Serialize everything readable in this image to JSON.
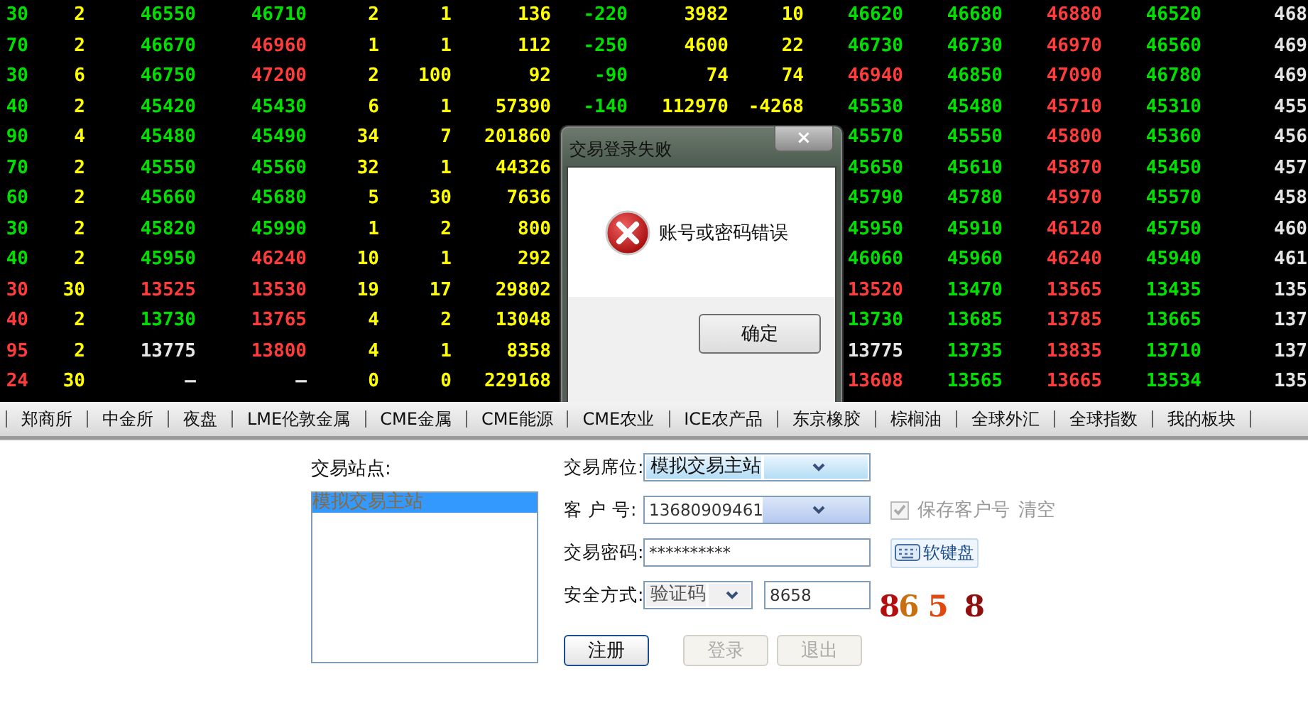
{
  "quotes": {
    "rows": [
      {
        "cells": [
          {
            "text": "30",
            "color": "#00e000"
          },
          {
            "text": "2",
            "color": "#ffff00"
          },
          {
            "text": "46550",
            "color": "#00e000"
          },
          {
            "text": "46710",
            "color": "#00e000"
          },
          {
            "text": "2",
            "color": "#ffff00"
          },
          {
            "text": "1",
            "color": "#ffff00"
          },
          {
            "text": "136",
            "color": "#ffff00"
          },
          {
            "text": "-220",
            "color": "#00e000"
          },
          {
            "text": "3982",
            "color": "#ffff00"
          },
          {
            "text": "10",
            "color": "#ffff00"
          },
          {
            "text": "46620",
            "color": "#00e000"
          },
          {
            "text": "46680",
            "color": "#00e000"
          },
          {
            "text": "46880",
            "color": "#ff3c3c"
          },
          {
            "text": "46520",
            "color": "#00e000"
          },
          {
            "text": "468",
            "color": "#e6e6e6"
          }
        ]
      },
      {
        "cells": [
          {
            "text": "70",
            "color": "#00e000"
          },
          {
            "text": "2",
            "color": "#ffff00"
          },
          {
            "text": "46670",
            "color": "#00e000"
          },
          {
            "text": "46960",
            "color": "#ff3c3c"
          },
          {
            "text": "1",
            "color": "#ffff00"
          },
          {
            "text": "1",
            "color": "#ffff00"
          },
          {
            "text": "112",
            "color": "#ffff00"
          },
          {
            "text": "-250",
            "color": "#00e000"
          },
          {
            "text": "4600",
            "color": "#ffff00"
          },
          {
            "text": "22",
            "color": "#ffff00"
          },
          {
            "text": "46730",
            "color": "#00e000"
          },
          {
            "text": "46730",
            "color": "#00e000"
          },
          {
            "text": "46970",
            "color": "#ff3c3c"
          },
          {
            "text": "46560",
            "color": "#00e000"
          },
          {
            "text": "469",
            "color": "#e6e6e6"
          }
        ]
      },
      {
        "cells": [
          {
            "text": "30",
            "color": "#00e000"
          },
          {
            "text": "6",
            "color": "#ffff00"
          },
          {
            "text": "46750",
            "color": "#00e000"
          },
          {
            "text": "47200",
            "color": "#ff3c3c"
          },
          {
            "text": "2",
            "color": "#ffff00"
          },
          {
            "text": "100",
            "color": "#ffff00"
          },
          {
            "text": "92",
            "color": "#ffff00"
          },
          {
            "text": "-90",
            "color": "#00e000"
          },
          {
            "text": "74",
            "color": "#ffff00"
          },
          {
            "text": "74",
            "color": "#ffff00"
          },
          {
            "text": "46940",
            "color": "#ff3c3c"
          },
          {
            "text": "46850",
            "color": "#00e000"
          },
          {
            "text": "47090",
            "color": "#ff3c3c"
          },
          {
            "text": "46780",
            "color": "#00e000"
          },
          {
            "text": "469",
            "color": "#e6e6e6"
          }
        ]
      },
      {
        "cells": [
          {
            "text": "40",
            "color": "#00e000"
          },
          {
            "text": "2",
            "color": "#ffff00"
          },
          {
            "text": "45420",
            "color": "#00e000"
          },
          {
            "text": "45430",
            "color": "#00e000"
          },
          {
            "text": "6",
            "color": "#ffff00"
          },
          {
            "text": "1",
            "color": "#ffff00"
          },
          {
            "text": "57390",
            "color": "#ffff00"
          },
          {
            "text": "-140",
            "color": "#00e000"
          },
          {
            "text": "112970",
            "color": "#ffff00"
          },
          {
            "text": "-4268",
            "color": "#ffff00"
          },
          {
            "text": "45530",
            "color": "#00e000"
          },
          {
            "text": "45480",
            "color": "#00e000"
          },
          {
            "text": "45710",
            "color": "#ff3c3c"
          },
          {
            "text": "45310",
            "color": "#00e000"
          },
          {
            "text": "455",
            "color": "#e6e6e6"
          }
        ]
      },
      {
        "cells": [
          {
            "text": "90",
            "color": "#00e000"
          },
          {
            "text": "4",
            "color": "#ffff00"
          },
          {
            "text": "45480",
            "color": "#00e000"
          },
          {
            "text": "45490",
            "color": "#00e000"
          },
          {
            "text": "34",
            "color": "#ffff00"
          },
          {
            "text": "7",
            "color": "#ffff00"
          },
          {
            "text": "201860",
            "color": "#ffff00"
          },
          null,
          null,
          null,
          {
            "text": "45570",
            "color": "#00e000"
          },
          {
            "text": "45550",
            "color": "#00e000"
          },
          {
            "text": "45800",
            "color": "#ff3c3c"
          },
          {
            "text": "45360",
            "color": "#00e000"
          },
          {
            "text": "456",
            "color": "#e6e6e6"
          }
        ]
      },
      {
        "cells": [
          {
            "text": "70",
            "color": "#00e000"
          },
          {
            "text": "2",
            "color": "#ffff00"
          },
          {
            "text": "45550",
            "color": "#00e000"
          },
          {
            "text": "45560",
            "color": "#00e000"
          },
          {
            "text": "32",
            "color": "#ffff00"
          },
          {
            "text": "1",
            "color": "#ffff00"
          },
          {
            "text": "44326",
            "color": "#ffff00"
          },
          null,
          null,
          null,
          {
            "text": "45650",
            "color": "#00e000"
          },
          {
            "text": "45610",
            "color": "#00e000"
          },
          {
            "text": "45870",
            "color": "#ff3c3c"
          },
          {
            "text": "45450",
            "color": "#00e000"
          },
          {
            "text": "457",
            "color": "#e6e6e6"
          }
        ]
      },
      {
        "cells": [
          {
            "text": "60",
            "color": "#00e000"
          },
          {
            "text": "2",
            "color": "#ffff00"
          },
          {
            "text": "45660",
            "color": "#00e000"
          },
          {
            "text": "45680",
            "color": "#00e000"
          },
          {
            "text": "5",
            "color": "#ffff00"
          },
          {
            "text": "30",
            "color": "#ffff00"
          },
          {
            "text": "7636",
            "color": "#ffff00"
          },
          null,
          null,
          null,
          {
            "text": "45790",
            "color": "#00e000"
          },
          {
            "text": "45780",
            "color": "#00e000"
          },
          {
            "text": "45970",
            "color": "#ff3c3c"
          },
          {
            "text": "45570",
            "color": "#00e000"
          },
          {
            "text": "458",
            "color": "#e6e6e6"
          }
        ]
      },
      {
        "cells": [
          {
            "text": "30",
            "color": "#00e000"
          },
          {
            "text": "2",
            "color": "#ffff00"
          },
          {
            "text": "45820",
            "color": "#00e000"
          },
          {
            "text": "45990",
            "color": "#00e000"
          },
          {
            "text": "1",
            "color": "#ffff00"
          },
          {
            "text": "2",
            "color": "#ffff00"
          },
          {
            "text": "800",
            "color": "#ffff00"
          },
          null,
          null,
          null,
          {
            "text": "45950",
            "color": "#00e000"
          },
          {
            "text": "45910",
            "color": "#00e000"
          },
          {
            "text": "46120",
            "color": "#ff3c3c"
          },
          {
            "text": "45750",
            "color": "#00e000"
          },
          {
            "text": "460",
            "color": "#e6e6e6"
          }
        ]
      },
      {
        "cells": [
          {
            "text": "40",
            "color": "#00e000"
          },
          {
            "text": "2",
            "color": "#ffff00"
          },
          {
            "text": "45950",
            "color": "#00e000"
          },
          {
            "text": "46240",
            "color": "#ff3c3c"
          },
          {
            "text": "10",
            "color": "#ffff00"
          },
          {
            "text": "1",
            "color": "#ffff00"
          },
          {
            "text": "292",
            "color": "#ffff00"
          },
          null,
          null,
          null,
          {
            "text": "46060",
            "color": "#00e000"
          },
          {
            "text": "45960",
            "color": "#00e000"
          },
          {
            "text": "46240",
            "color": "#ff3c3c"
          },
          {
            "text": "45940",
            "color": "#00e000"
          },
          {
            "text": "461",
            "color": "#e6e6e6"
          }
        ]
      },
      {
        "cells": [
          {
            "text": "30",
            "color": "#ff3c3c"
          },
          {
            "text": "30",
            "color": "#ffff00"
          },
          {
            "text": "13525",
            "color": "#ff3c3c"
          },
          {
            "text": "13530",
            "color": "#ff3c3c"
          },
          {
            "text": "19",
            "color": "#ffff00"
          },
          {
            "text": "17",
            "color": "#ffff00"
          },
          {
            "text": "29802",
            "color": "#ffff00"
          },
          null,
          null,
          null,
          {
            "text": "13520",
            "color": "#ff3c3c"
          },
          {
            "text": "13470",
            "color": "#00e000"
          },
          {
            "text": "13565",
            "color": "#ff3c3c"
          },
          {
            "text": "13435",
            "color": "#00e000"
          },
          {
            "text": "135",
            "color": "#e6e6e6"
          }
        ]
      },
      {
        "cells": [
          {
            "text": "40",
            "color": "#ff3c3c"
          },
          {
            "text": "2",
            "color": "#ffff00"
          },
          {
            "text": "13730",
            "color": "#00e000"
          },
          {
            "text": "13765",
            "color": "#ff3c3c"
          },
          {
            "text": "4",
            "color": "#ffff00"
          },
          {
            "text": "2",
            "color": "#ffff00"
          },
          {
            "text": "13048",
            "color": "#ffff00"
          },
          null,
          null,
          null,
          {
            "text": "13730",
            "color": "#00e000"
          },
          {
            "text": "13685",
            "color": "#00e000"
          },
          {
            "text": "13785",
            "color": "#ff3c3c"
          },
          {
            "text": "13665",
            "color": "#00e000"
          },
          {
            "text": "137",
            "color": "#e6e6e6"
          }
        ]
      },
      {
        "cells": [
          {
            "text": "95",
            "color": "#ff3c3c"
          },
          {
            "text": "2",
            "color": "#ffff00"
          },
          {
            "text": "13775",
            "color": "#e6e6e6"
          },
          {
            "text": "13800",
            "color": "#ff3c3c"
          },
          {
            "text": "4",
            "color": "#ffff00"
          },
          {
            "text": "1",
            "color": "#ffff00"
          },
          {
            "text": "8358",
            "color": "#ffff00"
          },
          null,
          null,
          null,
          {
            "text": "13775",
            "color": "#e6e6e6"
          },
          {
            "text": "13735",
            "color": "#00e000"
          },
          {
            "text": "13835",
            "color": "#ff3c3c"
          },
          {
            "text": "13710",
            "color": "#00e000"
          },
          {
            "text": "137",
            "color": "#e6e6e6"
          }
        ]
      },
      {
        "cells": [
          {
            "text": "24",
            "color": "#ff3c3c"
          },
          {
            "text": "30",
            "color": "#ffff00"
          },
          {
            "text": "—",
            "color": "#e6e6e6"
          },
          {
            "text": "—",
            "color": "#e6e6e6"
          },
          {
            "text": "0",
            "color": "#ffff00"
          },
          {
            "text": "0",
            "color": "#ffff00"
          },
          {
            "text": "229168",
            "color": "#ffff00"
          },
          null,
          null,
          null,
          {
            "text": "13608",
            "color": "#ff3c3c"
          },
          {
            "text": "13565",
            "color": "#00e000"
          },
          {
            "text": "13665",
            "color": "#ff3c3c"
          },
          {
            "text": "13534",
            "color": "#00e000"
          },
          {
            "text": "135",
            "color": "#e6e6e6"
          }
        ]
      }
    ]
  },
  "dialog": {
    "title": "交易登录失败",
    "close": "×",
    "message": "账号或密码错误",
    "button": "确定"
  },
  "market_tabs": [
    {
      "label": "郑商所"
    },
    {
      "label": "中金所"
    },
    {
      "label": "夜盘"
    },
    {
      "label": "LME伦敦金属"
    },
    {
      "label": "CME金属"
    },
    {
      "label": "CME能源"
    },
    {
      "label": "CME农业"
    },
    {
      "label": "ICE农产品"
    },
    {
      "label": "东京橡胶"
    },
    {
      "label": "棕榈油"
    },
    {
      "label": "全球外汇"
    },
    {
      "label": "全球指数"
    },
    {
      "label": "我的板块"
    }
  ],
  "login": {
    "stations_label": "交易站点:",
    "stations": [
      {
        "label": "模拟交易主站",
        "selected": true
      }
    ],
    "seat_label": "交易席位:",
    "seat": "模拟交易主站",
    "account_label": "客 户 号:",
    "account": "13680909461",
    "save_account": {
      "label": "保存客户号",
      "checked": true,
      "disabled": true
    },
    "clear": "清空",
    "password_label": "交易密码:",
    "password": "**********",
    "soft_keyboard": "软键盘",
    "security_label": "安全方式:",
    "security": "验证码",
    "code": "8658",
    "captcha": [
      {
        "text": "8",
        "color": "#b40f0f"
      },
      {
        "text": "6",
        "color": "#c87010"
      },
      {
        "text": "5",
        "color": "#e04a10"
      },
      {
        "text": "8",
        "color": "#901010"
      }
    ],
    "buttons": [
      {
        "label": "注册",
        "disabled": false
      },
      {
        "label": "登录",
        "disabled": true
      },
      {
        "label": "退出",
        "disabled": true
      }
    ]
  }
}
